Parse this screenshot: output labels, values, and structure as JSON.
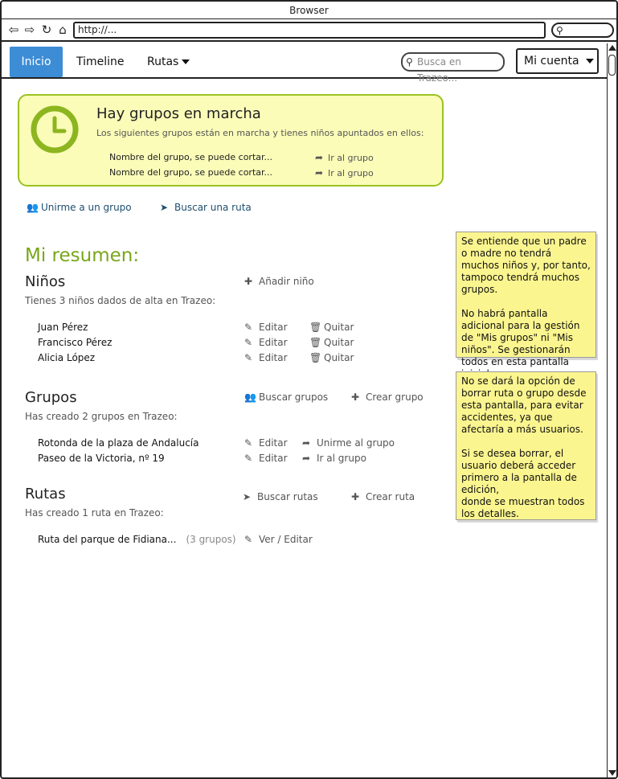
{
  "browser": {
    "title": "Browser",
    "url": "http://..."
  },
  "navbar": {
    "home": "Inicio",
    "timeline": "Timeline",
    "routes": "Rutas",
    "search_placeholder": "Busca en Trazeo...",
    "account": "Mi cuenta"
  },
  "alert": {
    "title": "Hay grupos en marcha",
    "subtitle": "Los siguientes grupos están en marcha y tienes niños apuntados en ellos:",
    "rows": [
      {
        "name": "Nombre del grupo, se puede cortar...",
        "action": "Ir al grupo"
      },
      {
        "name": "Nombre del grupo, se puede cortar...",
        "action": "Ir al grupo"
      }
    ]
  },
  "quick_links": {
    "join": "Unirme a un grupo",
    "find_route": "Buscar una ruta"
  },
  "summary": {
    "title": "Mi resumen:",
    "children": {
      "heading": "Niños",
      "add": "Añadir niño",
      "subtitle": "Tienes 3 niños dados de alta en Trazeo:",
      "items": [
        {
          "name": "Juan Pérez",
          "edit": "Editar",
          "remove": "Quitar"
        },
        {
          "name": "Francisco Pérez",
          "edit": "Editar",
          "remove": "Quitar"
        },
        {
          "name": "Alicia López",
          "edit": "Editar",
          "remove": "Quitar"
        }
      ]
    },
    "groups": {
      "heading": "Grupos",
      "search": "Buscar grupos",
      "create": "Crear grupo",
      "subtitle": "Has creado 2 grupos en Trazeo:",
      "items": [
        {
          "name": "Rotonda de la plaza de Andalucía",
          "edit": "Editar",
          "action": "Unirme al grupo"
        },
        {
          "name": "Paseo de la Victoria, nº 19",
          "edit": "Editar",
          "action": "Ir al grupo"
        }
      ]
    },
    "routes": {
      "heading": "Rutas",
      "search": "Buscar rutas",
      "create": "Crear ruta",
      "subtitle": "Has creado 1 ruta en Trazeo:",
      "items": [
        {
          "name": "Ruta del parque de Fidiana...",
          "extra": "(3 grupos)",
          "action": "Ver / Editar"
        }
      ]
    }
  },
  "notes": [
    "Se entiende que un padre o madre no tendrá muchos niños y, por tanto, tampoco tendrá muchos grupos.\n\nNo habrá pantalla adicional para la gestión de \"Mis grupos\" ni \"Mis niños\". Se gestionarán todos en esta pantalla inicial.",
    "No se dará la opción de borrar ruta o grupo desde esta pantalla, para evitar accidentes, ya que afectaría a más usuarios.\n\nSi se desea borrar, el usuario deberá acceder primero a la pantalla de edición,\n donde se muestran todos los detalles."
  ],
  "colors": {
    "accent_blue": "#3d8dd6",
    "green": "#79a61a",
    "alert_bg": "#fafcb8",
    "note_bg": "#fbf58f"
  }
}
